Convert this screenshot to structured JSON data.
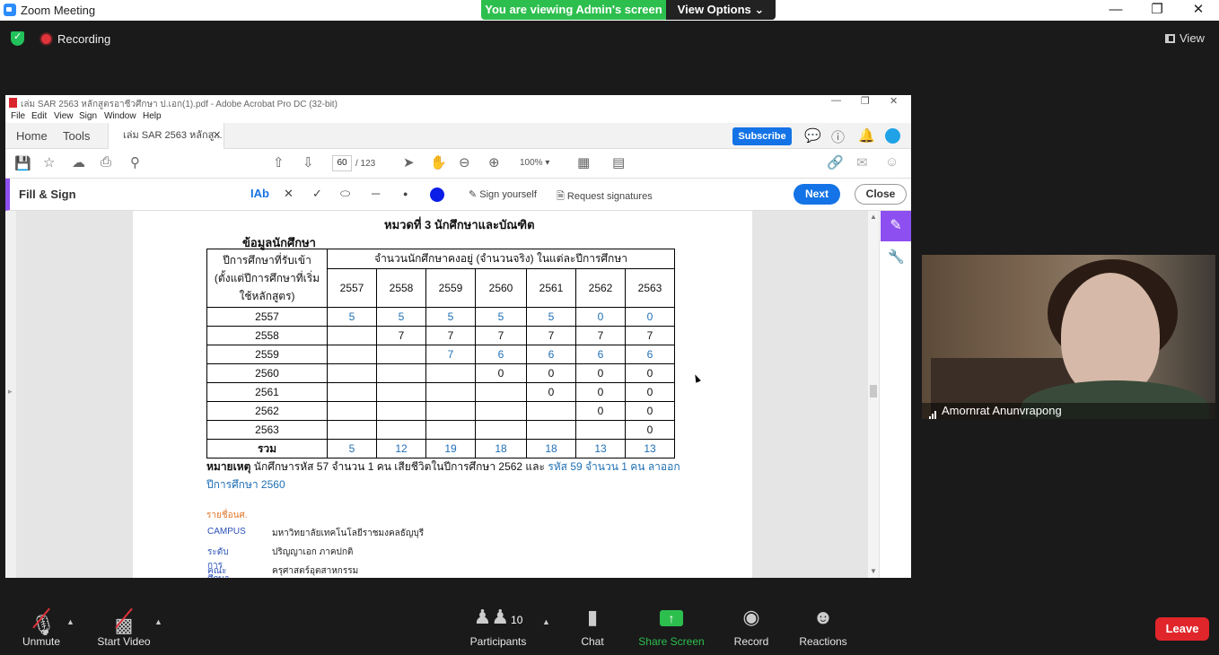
{
  "zoom": {
    "window_title": "Zoom Meeting",
    "banner_text": "You are viewing Admin's screen",
    "view_options_label": "View Options",
    "recording_label": "Recording",
    "view_label": "View",
    "participant_name": "Amornrat Anunvrapong"
  },
  "acrobat": {
    "window_title": "เล่ม SAR 2563 หลักสูตรอาชีวศึกษา ป.เอก(1).pdf - Adobe Acrobat Pro DC (32-bit)",
    "menu": [
      "File",
      "Edit",
      "View",
      "Sign",
      "Window",
      "Help"
    ],
    "tabs": {
      "home": "Home",
      "tools": "Tools",
      "doc": "เล่ม SAR 2563 หลักสู..."
    },
    "subscribe_label": "Subscribe",
    "page_current": "60",
    "page_total": "/ 123",
    "zoom_level": "100%",
    "fill_sign_title": "Fill & Sign",
    "text_tool_label": "IAb",
    "sign_yourself_label": "Sign yourself",
    "request_signatures_label": "Request signatures",
    "next_label": "Next",
    "close_label": "Close",
    "fill_color": "#0a1ee8",
    "accent_color": "#8e4ff0"
  },
  "document": {
    "section_title": "หมวดที่ 3 นักศึกษาและบัณฑิต",
    "subtitle": "ข้อมูลนักศึกษา",
    "table": {
      "row_header": "ปีการศึกษาที่รับเข้า (ตั้งแต่ปีการศึกษาที่เริ่มใช้หลักสูตร)",
      "group_header": "จำนวนนักศึกษาคงอยู่ (จำนวนจริง) ในแต่ละปีการศึกษา",
      "years": [
        "2557",
        "2558",
        "2559",
        "2560",
        "2561",
        "2562",
        "2563"
      ],
      "rows": [
        {
          "year": "2557",
          "cells": [
            "5",
            "5",
            "5",
            "5",
            "5",
            "0",
            "0"
          ]
        },
        {
          "year": "2558",
          "cells": [
            "",
            "7",
            "7",
            "7",
            "7",
            "7",
            "7"
          ]
        },
        {
          "year": "2559",
          "cells": [
            "",
            "",
            "7",
            "6",
            "6",
            "6",
            "6"
          ]
        },
        {
          "year": "2560",
          "cells": [
            "",
            "",
            "",
            "0",
            "0",
            "0",
            "0"
          ]
        },
        {
          "year": "2561",
          "cells": [
            "",
            "",
            "",
            "",
            "0",
            "0",
            "0"
          ]
        },
        {
          "year": "2562",
          "cells": [
            "",
            "",
            "",
            "",
            "",
            "0",
            "0"
          ]
        },
        {
          "year": "2563",
          "cells": [
            "",
            "",
            "",
            "",
            "",
            "",
            "0"
          ]
        }
      ],
      "total_label": "รวม",
      "totals": [
        "5",
        "12",
        "19",
        "18",
        "18",
        "13",
        "13"
      ]
    },
    "note_label": "หมายเหตุ",
    "note_text": "นักศึกษารหัส 57 จำนวน 1 คน เสียชีวิตในปีการศึกษา 2562 และ",
    "note_text_blue": "รหัส 59 จำนวน 1 คน ลาออกปีการศึกษา 2560",
    "list_heading": "รายชื่อนศ.",
    "list": [
      {
        "key": "CAMPUS",
        "value": "มหาวิทยาลัยเทคโนโลยีราชมงคลธัญบุรี"
      },
      {
        "key": "ระดับการศึกษา",
        "value": "ปริญญาเอก ภาคปกติ"
      },
      {
        "key": "คณะ",
        "value": "ครุศาสตร์อุตสาหกรรม"
      }
    ]
  },
  "toolbar": {
    "unmute": "Unmute",
    "start_video": "Start Video",
    "participants": "Participants",
    "participants_count": "10",
    "chat": "Chat",
    "share_screen": "Share Screen",
    "record": "Record",
    "reactions": "Reactions",
    "leave": "Leave"
  }
}
